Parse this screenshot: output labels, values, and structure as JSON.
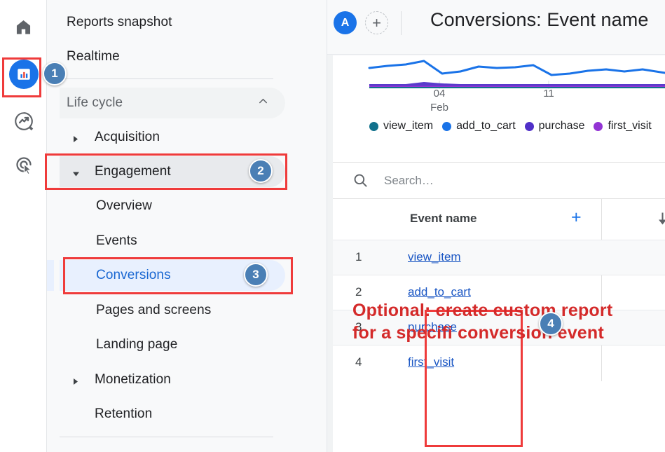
{
  "icon_rail": {
    "items": [
      {
        "name": "home-icon",
        "label": "Home"
      },
      {
        "name": "reports-icon",
        "label": "Reports"
      },
      {
        "name": "explore-icon",
        "label": "Explore"
      },
      {
        "name": "advertising-icon",
        "label": "Advertising"
      }
    ]
  },
  "sidebar": {
    "items": [
      {
        "label": "Reports snapshot"
      },
      {
        "label": "Realtime"
      },
      {
        "label": "Life cycle"
      },
      {
        "label": "Acquisition"
      },
      {
        "label": "Engagement"
      },
      {
        "label": "Overview"
      },
      {
        "label": "Events"
      },
      {
        "label": "Conversions"
      },
      {
        "label": "Pages and screens"
      },
      {
        "label": "Landing page"
      },
      {
        "label": "Monetization"
      },
      {
        "label": "Retention"
      }
    ]
  },
  "header": {
    "account_initial": "A",
    "add_comparison_label": "+",
    "title": "Conversions: Event name"
  },
  "chart_data": {
    "type": "line",
    "title": "",
    "xlabel": "",
    "ylabel": "",
    "grid": false,
    "legend_position": "bottom",
    "tick_labels": [
      {
        "value": "04",
        "sub": "Feb"
      },
      {
        "value": "11",
        "sub": ""
      }
    ],
    "series": [
      {
        "name": "view_item",
        "color": "#11718c",
        "values": [
          0.5,
          0.5,
          0.5,
          0.5,
          0.5,
          0.5,
          0.5,
          0.5,
          0.5,
          0.5,
          0.5,
          0.5,
          0.5,
          0.5,
          0.5,
          0.5,
          0.5
        ]
      },
      {
        "name": "add_to_cart",
        "color": "#1a73e8",
        "values": [
          29,
          33,
          35,
          42,
          22,
          26,
          33,
          31,
          30,
          35,
          20,
          22,
          26,
          29,
          25,
          28,
          25
        ]
      },
      {
        "name": "purchase",
        "color": "#5030c8",
        "values": [
          8,
          8,
          11,
          9,
          7,
          7,
          7,
          7,
          7,
          7,
          7,
          7,
          7,
          7,
          7,
          7,
          7
        ]
      },
      {
        "name": "first_visit",
        "color": "#9334d4",
        "values": [
          4,
          4,
          4,
          4,
          4,
          4,
          4,
          4,
          4,
          4,
          4,
          4,
          4,
          4,
          4,
          4,
          4
        ]
      }
    ]
  },
  "search": {
    "placeholder": "Search…",
    "value": ""
  },
  "table": {
    "columns": [
      {
        "label": "Event name"
      },
      {
        "label": ""
      }
    ],
    "add_column_label": "+",
    "rows": [
      {
        "index": "1",
        "event_name": "view_item"
      },
      {
        "index": "2",
        "event_name": "add_to_cart"
      },
      {
        "index": "3",
        "event_name": "purchase"
      },
      {
        "index": "4",
        "event_name": "first_visit"
      }
    ]
  },
  "annotations": {
    "note": "Optional: create custom report\nfor a specifi conversion event",
    "steps": [
      {
        "number": "1"
      },
      {
        "number": "2"
      },
      {
        "number": "3"
      },
      {
        "number": "4"
      }
    ],
    "highlight_color": "#ef3b3b",
    "note_color": "#d42a2a",
    "badge_color": "#4a7fb5"
  }
}
